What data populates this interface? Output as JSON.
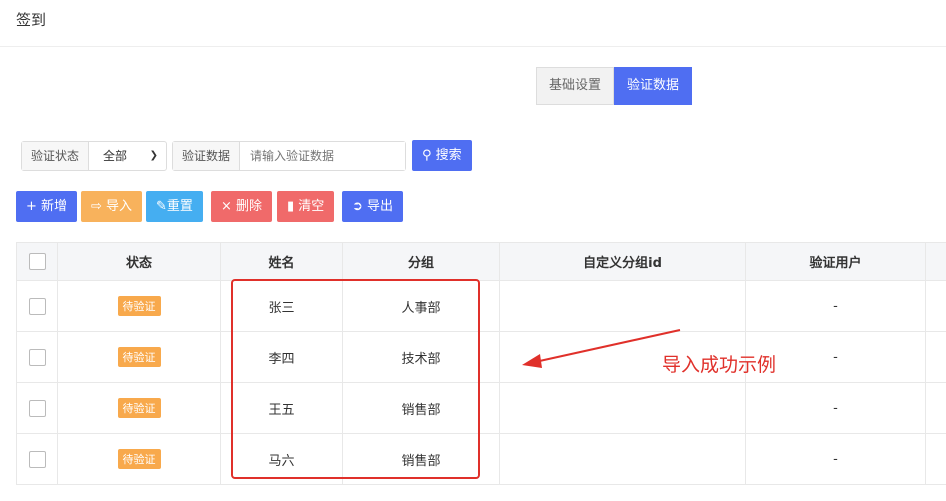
{
  "page_title": "签到",
  "tabs": [
    {
      "label": "基础设置",
      "active": false
    },
    {
      "label": "验证数据",
      "active": true
    }
  ],
  "filters": {
    "status_label": "验证状态",
    "status_value": "全部",
    "data_label": "验证数据",
    "data_placeholder": "请输入验证数据",
    "search_label": "搜索"
  },
  "toolbar": {
    "add": "新增",
    "import": "导入",
    "reset": "重置",
    "delete": "删除",
    "clear": "清空",
    "export": "导出"
  },
  "colors": {
    "primary": "#4f6ef2",
    "warning": "#f8b25c",
    "info": "#45aef1",
    "danger": "#f06a6a",
    "annotation": "#e0302a"
  },
  "table": {
    "headers": [
      "状态",
      "姓名",
      "分组",
      "自定义分组id",
      "验证用户",
      ""
    ],
    "rows": [
      {
        "status": "待验证",
        "name": "张三",
        "group": "人事部",
        "custom_id": "",
        "user": "-"
      },
      {
        "status": "待验证",
        "name": "李四",
        "group": "技术部",
        "custom_id": "",
        "user": "-"
      },
      {
        "status": "待验证",
        "name": "王五",
        "group": "销售部",
        "custom_id": "",
        "user": "-"
      },
      {
        "status": "待验证",
        "name": "马六",
        "group": "销售部",
        "custom_id": "",
        "user": "-"
      }
    ]
  },
  "annotation": "导入成功示例"
}
